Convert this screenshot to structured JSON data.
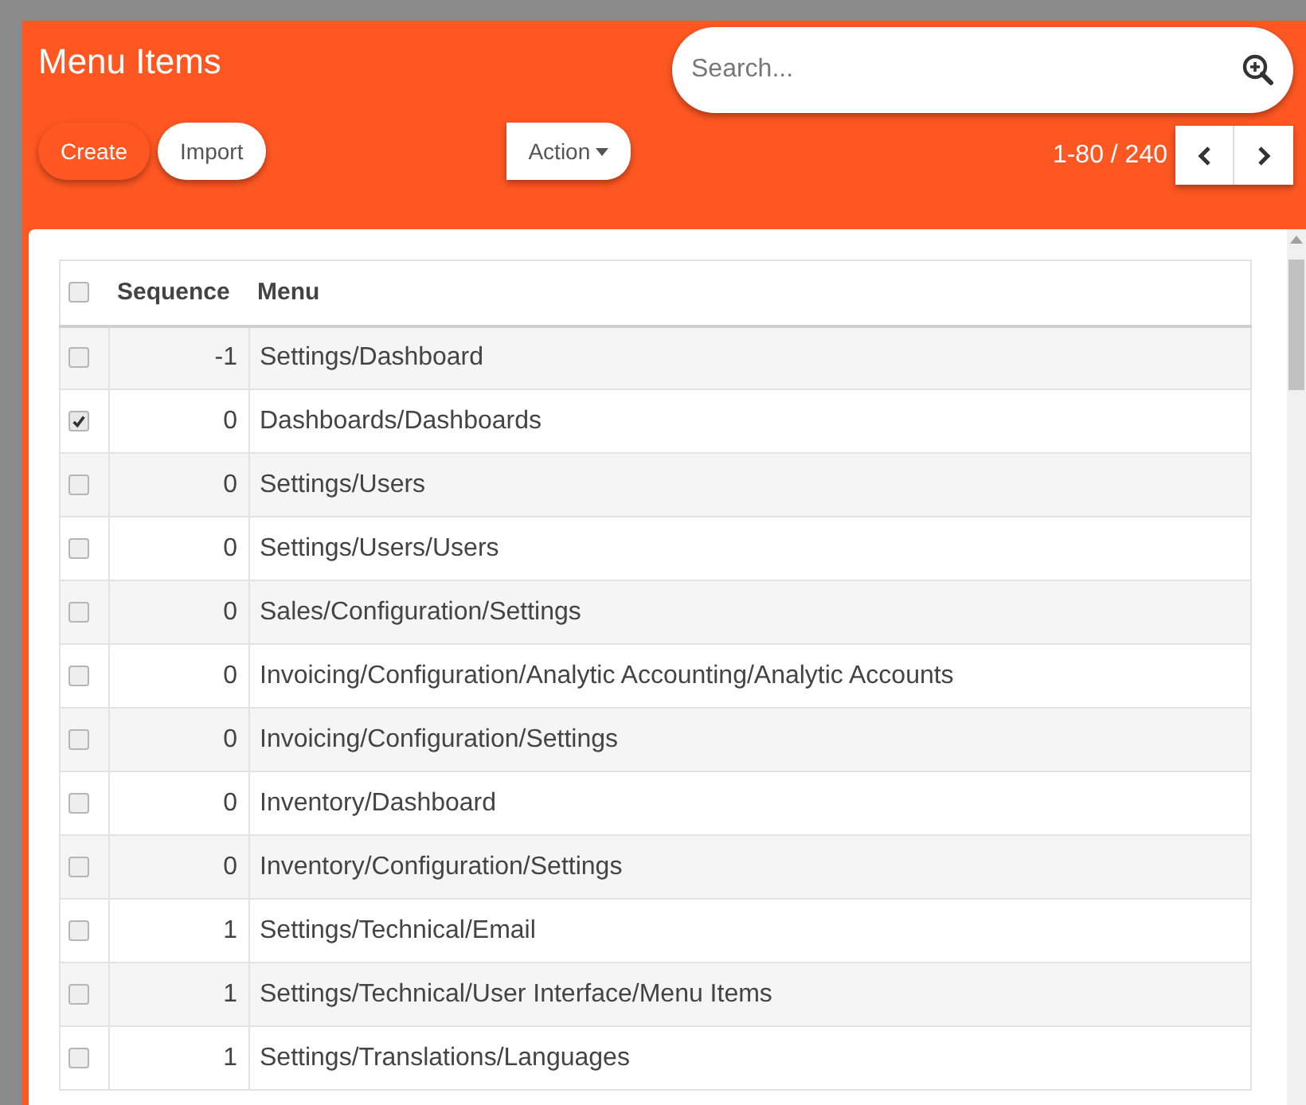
{
  "title": "Menu Items",
  "search": {
    "placeholder": "Search..."
  },
  "buttons": [
    {
      "label": "Create",
      "kind": "primary"
    },
    {
      "label": "Import",
      "kind": "secondary"
    }
  ],
  "action_menu": {
    "label": "Action"
  },
  "pager": {
    "range": "1-80 / 240"
  },
  "table": {
    "select_all": {
      "checked": false
    },
    "columns": [
      "Sequence",
      "Menu"
    ],
    "rows": [
      {
        "sequence": "-1",
        "menu": "Settings/Dashboard",
        "checked": false
      },
      {
        "sequence": "0",
        "menu": "Dashboards/Dashboards",
        "checked": true
      },
      {
        "sequence": "0",
        "menu": "Settings/Users",
        "checked": false
      },
      {
        "sequence": "0",
        "menu": "Settings/Users/Users",
        "checked": false
      },
      {
        "sequence": "0",
        "menu": "Sales/Configuration/Settings",
        "checked": false
      },
      {
        "sequence": "0",
        "menu": "Invoicing/Configuration/Analytic Accounting/Analytic Accounts",
        "checked": false
      },
      {
        "sequence": "0",
        "menu": "Invoicing/Configuration/Settings",
        "checked": false
      },
      {
        "sequence": "0",
        "menu": "Inventory/Dashboard",
        "checked": false
      },
      {
        "sequence": "0",
        "menu": "Inventory/Configuration/Settings",
        "checked": false
      },
      {
        "sequence": "1",
        "menu": "Settings/Technical/Email",
        "checked": false
      },
      {
        "sequence": "1",
        "menu": "Settings/Technical/User Interface/Menu Items",
        "checked": false
      },
      {
        "sequence": "1",
        "menu": "Settings/Translations/Languages",
        "checked": false
      }
    ]
  }
}
